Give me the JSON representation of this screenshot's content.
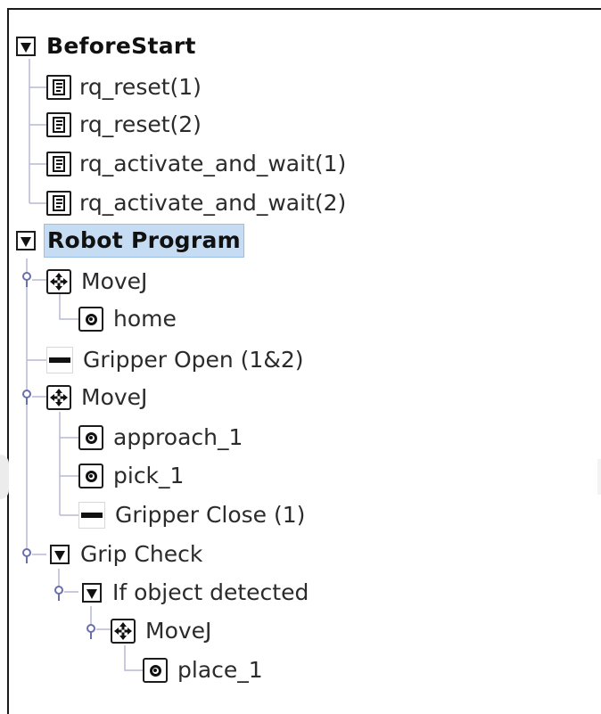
{
  "tree": {
    "before_start": {
      "label": "BeforeStart",
      "children": [
        {
          "label": "rq_reset(1)",
          "icon": "script-icon"
        },
        {
          "label": "rq_reset(2)",
          "icon": "script-icon"
        },
        {
          "label": "rq_activate_and_wait(1)",
          "icon": "script-icon"
        },
        {
          "label": "rq_activate_and_wait(2)",
          "icon": "script-icon"
        }
      ]
    },
    "robot_program": {
      "label": "Robot Program",
      "selected": true,
      "children": [
        {
          "label": "MoveJ",
          "icon": "move-icon",
          "children": [
            {
              "label": "home",
              "icon": "waypoint-icon"
            }
          ]
        },
        {
          "label": "Gripper Open (1&2)",
          "icon": "gripper-icon"
        },
        {
          "label": "MoveJ",
          "icon": "move-icon",
          "children": [
            {
              "label": "approach_1",
              "icon": "waypoint-icon"
            },
            {
              "label": "pick_1",
              "icon": "waypoint-icon"
            },
            {
              "label": "Gripper Close (1)",
              "icon": "gripper-icon"
            }
          ]
        },
        {
          "label": "Grip Check",
          "icon": "collapse-triangle-icon",
          "children": [
            {
              "label": "If object detected",
              "icon": "collapse-triangle-icon",
              "children": [
                {
                  "label": "MoveJ",
                  "icon": "move-icon",
                  "children": [
                    {
                      "label": "place_1",
                      "icon": "waypoint-icon"
                    }
                  ]
                }
              ]
            }
          ]
        }
      ]
    }
  },
  "colors": {
    "selection_bg": "#c5dcf3",
    "selection_border": "#9bbfe4",
    "tree_line": "#b7b9d6",
    "text": "#2b2b2b"
  }
}
